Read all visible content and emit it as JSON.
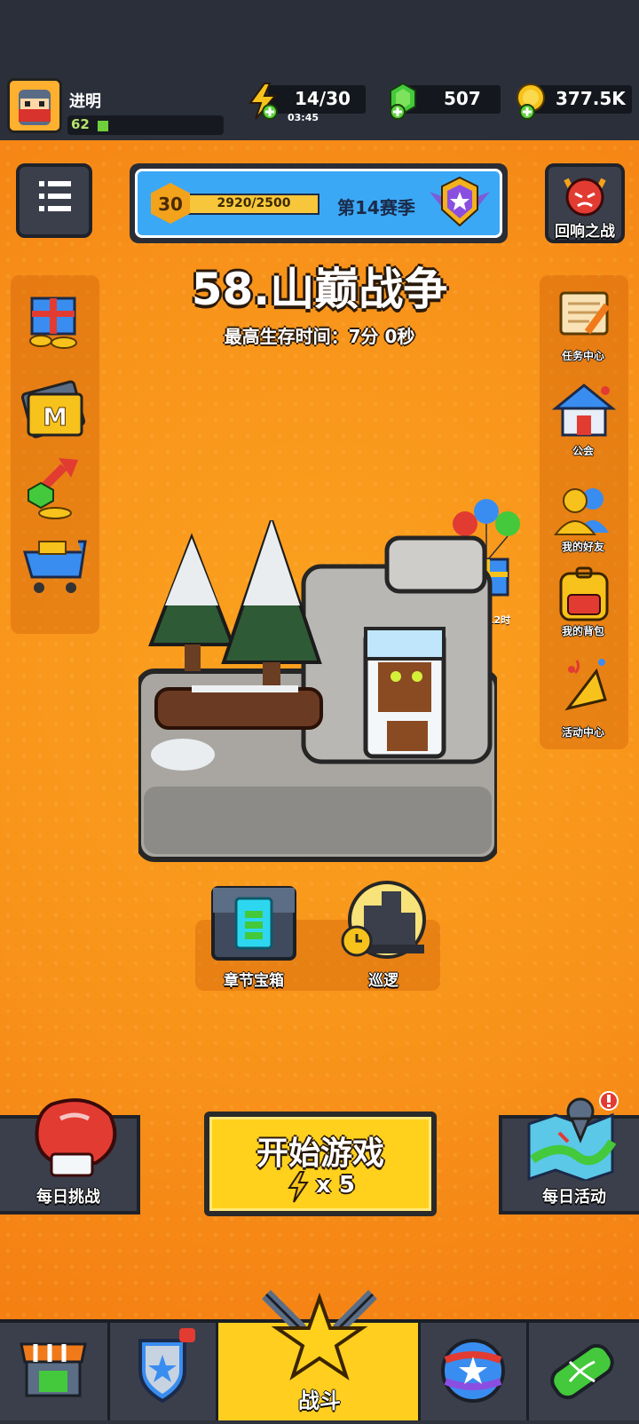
{
  "player": {
    "name": "进明",
    "level": "62",
    "level_progress": 0.05
  },
  "resources": [
    {
      "icon": "energy-icon",
      "value": "14/30",
      "timer": "03:45"
    },
    {
      "icon": "gem-icon",
      "value": "507"
    },
    {
      "icon": "coin-icon",
      "value": "377.5K"
    }
  ],
  "season": {
    "rank": "30",
    "xp_text": "2920/2500",
    "xp_progress": 1.0,
    "label": "第14赛季"
  },
  "echo_battle": {
    "label": "回响之战"
  },
  "stage": {
    "title": "58.山巅战争",
    "best_time": "最高生存时间：7分 0秒"
  },
  "right_menu": [
    {
      "icon": "task-scroll-icon",
      "label": "任务中心"
    },
    {
      "icon": "guild-house-icon",
      "label": "公会"
    },
    {
      "icon": "friends-icon",
      "label": "我的好友"
    },
    {
      "icon": "backpack-icon",
      "label": "我的背包"
    },
    {
      "icon": "party-popper-icon",
      "label": "活动中心"
    }
  ],
  "left_menu": [
    {
      "icon": "gift-coins-icon"
    },
    {
      "icon": "monthly-card-icon"
    },
    {
      "icon": "growth-fund-icon"
    },
    {
      "icon": "shop-cart-icon"
    }
  ],
  "balloon_gift": {
    "timer": "04天 12时"
  },
  "chapter_chest": {
    "label": "章节宝箱"
  },
  "patrol": {
    "label": "巡逻"
  },
  "start_game": {
    "label": "开始游戏",
    "cost": "x 5"
  },
  "daily_challenge": {
    "label": "每日挑战"
  },
  "daily_event": {
    "label": "每日活动"
  },
  "nav": {
    "battle_label": "战斗"
  },
  "colors": {
    "background": "#f6921e",
    "dark_ui": "#2b2f3a",
    "accent_yellow": "#ffd11c",
    "season_blue": "#3ba8f5"
  }
}
